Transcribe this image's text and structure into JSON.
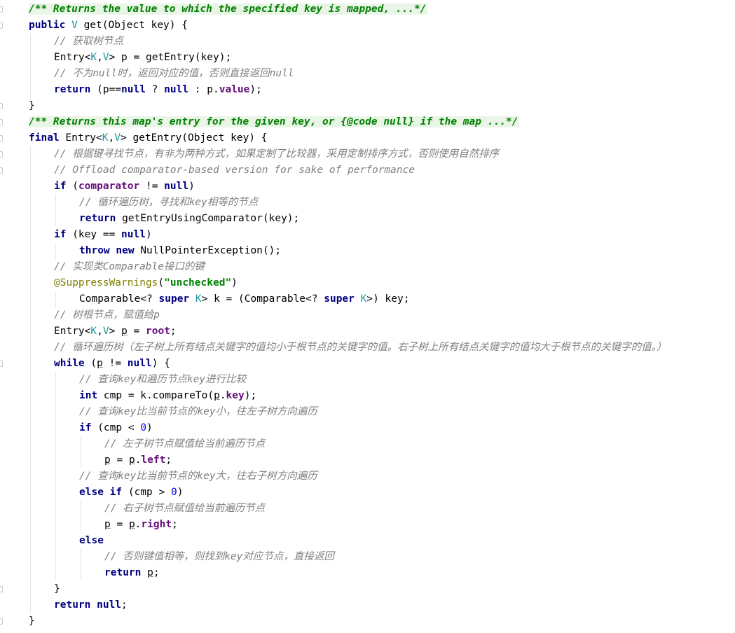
{
  "lines": [
    {
      "level": 0,
      "fold": true,
      "tokens": [
        {
          "t": "/** Returns the value to which the specified key is mapped, ...*/",
          "c": "doc"
        }
      ]
    },
    {
      "level": 0,
      "fold": true,
      "tokens": [
        {
          "t": "public ",
          "c": "kw"
        },
        {
          "t": "V",
          "c": "tp"
        },
        {
          "t": " get(Object key) {",
          "c": "tx"
        }
      ]
    },
    {
      "level": 1,
      "tokens": [
        {
          "t": "// 获取树节点",
          "c": "cm"
        }
      ]
    },
    {
      "level": 1,
      "tokens": [
        {
          "t": "Entry<",
          "c": "tx"
        },
        {
          "t": "K",
          "c": "tp"
        },
        {
          "t": ",",
          "c": "tx"
        },
        {
          "t": "V",
          "c": "tp"
        },
        {
          "t": "> p = getEntry(key);",
          "c": "tx"
        }
      ]
    },
    {
      "level": 1,
      "tokens": [
        {
          "t": "// 不为null时，返回对应的值，否则直接返回null",
          "c": "cm"
        }
      ]
    },
    {
      "level": 1,
      "tokens": [
        {
          "t": "return ",
          "c": "kw"
        },
        {
          "t": "(p==",
          "c": "tx"
        },
        {
          "t": "null",
          "c": "kw"
        },
        {
          "t": " ? ",
          "c": "tx"
        },
        {
          "t": "null",
          "c": "kw"
        },
        {
          "t": " : p.",
          "c": "tx"
        },
        {
          "t": "value",
          "c": "fld"
        },
        {
          "t": ");",
          "c": "tx"
        }
      ]
    },
    {
      "level": 0,
      "fold": true,
      "tokens": [
        {
          "t": "}",
          "c": "tx"
        }
      ]
    },
    {
      "level": 0,
      "fold": true,
      "tokens": [
        {
          "t": "/** Returns this map's entry for the given key, or {@code null} if the map ...*/",
          "c": "doc"
        }
      ]
    },
    {
      "level": 0,
      "fold": true,
      "tokens": [
        {
          "t": "final ",
          "c": "kw"
        },
        {
          "t": "Entry<",
          "c": "tx"
        },
        {
          "t": "K",
          "c": "tp"
        },
        {
          "t": ",",
          "c": "tx"
        },
        {
          "t": "V",
          "c": "tp"
        },
        {
          "t": "> getEntry(Object key) {",
          "c": "tx"
        }
      ]
    },
    {
      "level": 1,
      "fold": true,
      "tokens": [
        {
          "t": "// 根据键寻找节点，有非为两种方式，如果定制了比较器，采用定制排序方式，否则使用自然排序",
          "c": "cm"
        }
      ]
    },
    {
      "level": 1,
      "fold": true,
      "tokens": [
        {
          "t": "// Offload comparator-based version for sake of performance",
          "c": "cm"
        }
      ]
    },
    {
      "level": 1,
      "tokens": [
        {
          "t": "if ",
          "c": "kw"
        },
        {
          "t": "(",
          "c": "tx"
        },
        {
          "t": "comparator",
          "c": "fld"
        },
        {
          "t": " != ",
          "c": "tx"
        },
        {
          "t": "null",
          "c": "kw"
        },
        {
          "t": ")",
          "c": "tx"
        }
      ]
    },
    {
      "level": 2,
      "tokens": [
        {
          "t": "// 循环遍历树，寻找和key相等的节点",
          "c": "cm"
        }
      ]
    },
    {
      "level": 2,
      "tokens": [
        {
          "t": "return ",
          "c": "kw"
        },
        {
          "t": "getEntryUsingComparator(key);",
          "c": "tx"
        }
      ]
    },
    {
      "level": 1,
      "tokens": [
        {
          "t": "if ",
          "c": "kw"
        },
        {
          "t": "(key == ",
          "c": "tx"
        },
        {
          "t": "null",
          "c": "kw"
        },
        {
          "t": ")",
          "c": "tx"
        }
      ]
    },
    {
      "level": 2,
      "tokens": [
        {
          "t": "throw new ",
          "c": "kw"
        },
        {
          "t": "NullPointerException();",
          "c": "tx"
        }
      ]
    },
    {
      "level": 1,
      "tokens": [
        {
          "t": "// 实现类Comparable接口的键",
          "c": "cm"
        }
      ]
    },
    {
      "level": 1,
      "tokens": [
        {
          "t": "@SuppressWarnings",
          "c": "ann"
        },
        {
          "t": "(",
          "c": "tx"
        },
        {
          "t": "\"unchecked\"",
          "c": "str"
        },
        {
          "t": ")",
          "c": "tx"
        }
      ]
    },
    {
      "level": 2,
      "tokens": [
        {
          "t": "Comparable<? ",
          "c": "tx"
        },
        {
          "t": "super ",
          "c": "kw"
        },
        {
          "t": "K",
          "c": "tp"
        },
        {
          "t": "> k = (Comparable<? ",
          "c": "tx"
        },
        {
          "t": "super ",
          "c": "kw"
        },
        {
          "t": "K",
          "c": "tp"
        },
        {
          "t": ">) key;",
          "c": "tx"
        }
      ]
    },
    {
      "level": 1,
      "tokens": [
        {
          "t": "// 树根节点，赋值给p",
          "c": "cm"
        }
      ]
    },
    {
      "level": 1,
      "tokens": [
        {
          "t": "Entry<",
          "c": "tx"
        },
        {
          "t": "K",
          "c": "tp"
        },
        {
          "t": ",",
          "c": "tx"
        },
        {
          "t": "V",
          "c": "tp"
        },
        {
          "t": "> ",
          "c": "tx"
        },
        {
          "t": "p",
          "c": "ul"
        },
        {
          "t": " = ",
          "c": "tx"
        },
        {
          "t": "root",
          "c": "fld"
        },
        {
          "t": ";",
          "c": "tx"
        }
      ]
    },
    {
      "level": 1,
      "tokens": [
        {
          "t": "// 循环遍历树（左子树上所有结点关键字的值均小于根节点的关键字的值。右子树上所有结点关键字的值均大于根节点的关键字的值。）",
          "c": "cm"
        }
      ]
    },
    {
      "level": 1,
      "fold": true,
      "tokens": [
        {
          "t": "while ",
          "c": "kw"
        },
        {
          "t": "(",
          "c": "tx"
        },
        {
          "t": "p",
          "c": "ul"
        },
        {
          "t": " != ",
          "c": "tx"
        },
        {
          "t": "null",
          "c": "kw"
        },
        {
          "t": ") {",
          "c": "tx"
        }
      ]
    },
    {
      "level": 2,
      "tokens": [
        {
          "t": "// 查询key和遍历节点key进行比较",
          "c": "cm"
        }
      ]
    },
    {
      "level": 2,
      "tokens": [
        {
          "t": "int ",
          "c": "kw"
        },
        {
          "t": "cmp = k.compareTo(",
          "c": "tx"
        },
        {
          "t": "p",
          "c": "ul"
        },
        {
          "t": ".",
          "c": "tx"
        },
        {
          "t": "key",
          "c": "fld"
        },
        {
          "t": ");",
          "c": "tx"
        }
      ]
    },
    {
      "level": 2,
      "tokens": [
        {
          "t": "// 查询key比当前节点的key小，往左子树方向遍历",
          "c": "cm"
        }
      ]
    },
    {
      "level": 2,
      "tokens": [
        {
          "t": "if ",
          "c": "kw"
        },
        {
          "t": "(cmp < ",
          "c": "tx"
        },
        {
          "t": "0",
          "c": "num"
        },
        {
          "t": ")",
          "c": "tx"
        }
      ]
    },
    {
      "level": 3,
      "tokens": [
        {
          "t": "// 左子树节点赋值给当前遍历节点",
          "c": "cm"
        }
      ]
    },
    {
      "level": 3,
      "tokens": [
        {
          "t": "p",
          "c": "ul"
        },
        {
          "t": " = ",
          "c": "tx"
        },
        {
          "t": "p",
          "c": "ul"
        },
        {
          "t": ".",
          "c": "tx"
        },
        {
          "t": "left",
          "c": "fld"
        },
        {
          "t": ";",
          "c": "tx"
        }
      ]
    },
    {
      "level": 2,
      "tokens": [
        {
          "t": "// 查询key比当前节点的key大，往右子树方向遍历",
          "c": "cm"
        }
      ]
    },
    {
      "level": 2,
      "tokens": [
        {
          "t": "else if ",
          "c": "kw"
        },
        {
          "t": "(cmp > ",
          "c": "tx"
        },
        {
          "t": "0",
          "c": "num"
        },
        {
          "t": ")",
          "c": "tx"
        }
      ]
    },
    {
      "level": 3,
      "tokens": [
        {
          "t": "// 右子树节点赋值给当前遍历节点",
          "c": "cm"
        }
      ]
    },
    {
      "level": 3,
      "tokens": [
        {
          "t": "p",
          "c": "ul"
        },
        {
          "t": " = ",
          "c": "tx"
        },
        {
          "t": "p",
          "c": "ul"
        },
        {
          "t": ".",
          "c": "tx"
        },
        {
          "t": "right",
          "c": "fld"
        },
        {
          "t": ";",
          "c": "tx"
        }
      ]
    },
    {
      "level": 2,
      "tokens": [
        {
          "t": "else",
          "c": "kw"
        }
      ]
    },
    {
      "level": 3,
      "tokens": [
        {
          "t": "// 否则键值相等，则找到key对应节点，直接返回",
          "c": "cm"
        }
      ]
    },
    {
      "level": 3,
      "tokens": [
        {
          "t": "return ",
          "c": "kw"
        },
        {
          "t": "p",
          "c": "ul"
        },
        {
          "t": ";",
          "c": "tx"
        }
      ]
    },
    {
      "level": 1,
      "fold": true,
      "tokens": [
        {
          "t": "}",
          "c": "tx"
        }
      ]
    },
    {
      "level": 1,
      "tokens": [
        {
          "t": "return null",
          "c": "kw"
        },
        {
          "t": ";",
          "c": "tx"
        }
      ]
    },
    {
      "level": 0,
      "fold": true,
      "tokens": [
        {
          "t": "}",
          "c": "tx"
        }
      ]
    }
  ]
}
